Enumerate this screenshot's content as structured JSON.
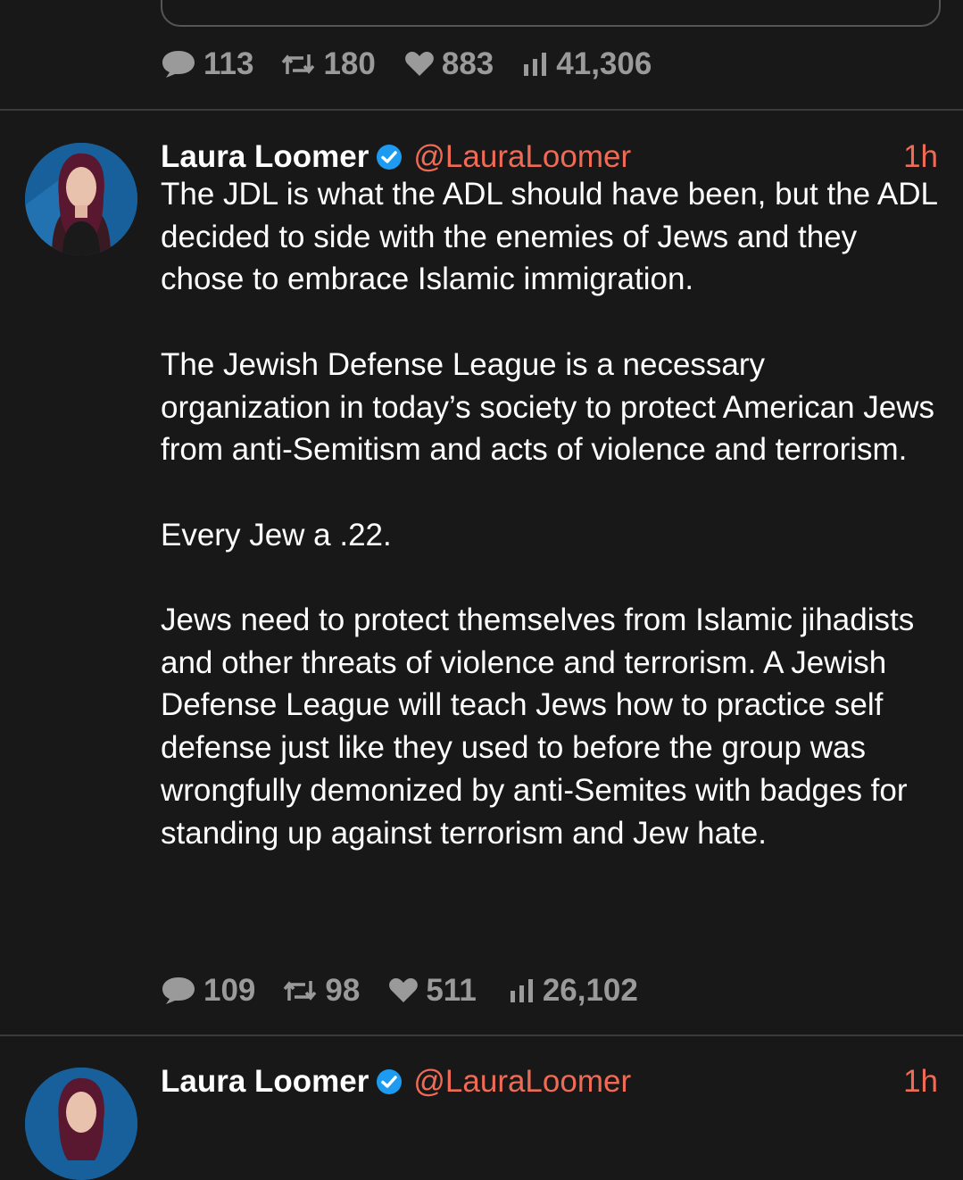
{
  "previous_tweet": {
    "stats": {
      "replies": "113",
      "retweets": "180",
      "likes": "883",
      "views": "41,306"
    }
  },
  "tweets": [
    {
      "author": {
        "name": "Laura Loomer",
        "handle": "@LauraLoomer",
        "verified": true
      },
      "time": "1h",
      "paragraphs": [
        "The JDL is what the ADL should have been, but the ADL decided to side with the enemies of Jews and they chose to embrace Islamic immigration.",
        "The Jewish Defense League is a necessary organization in today’s society to protect American Jews from anti-Semitism and acts of violence and terrorism.",
        "Every Jew a .22.",
        "Jews need to protect themselves from Islamic jihadists and other threats of violence and terrorism. A Jewish Defense League will teach Jews how to practice self defense just like they used to before the group was wrongfully demonized by anti-Semites with badges for standing up against terrorism and Jew hate."
      ],
      "stats": {
        "replies": "109",
        "retweets": "98",
        "likes": "511",
        "views": "26,102"
      }
    },
    {
      "author": {
        "name": "Laura Loomer",
        "handle": "@LauraLoomer",
        "verified": true
      },
      "time": "1h"
    }
  ],
  "colors": {
    "background": "#181818",
    "accent": "#ef6b55",
    "muted": "#9a9a9a",
    "verified": "#1d9bf0"
  },
  "icons": [
    "reply-icon",
    "retweet-icon",
    "like-icon",
    "views-icon",
    "verified-badge-icon"
  ]
}
